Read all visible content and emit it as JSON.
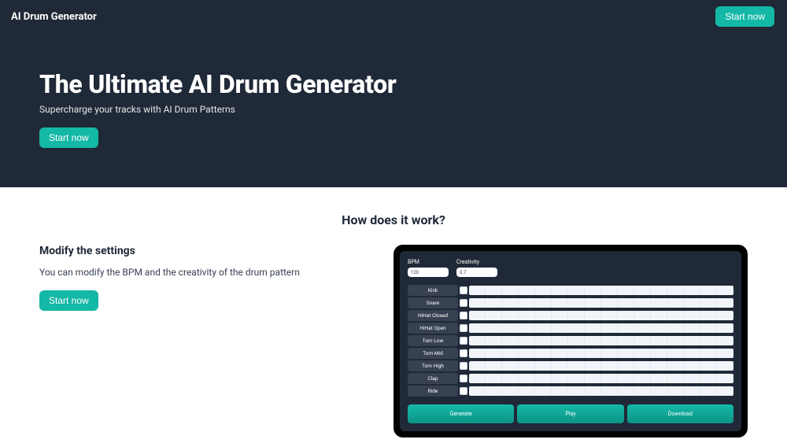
{
  "brand": "AI Drum Generator",
  "nav": {
    "cta": "Start now"
  },
  "hero": {
    "title": "The Ultimate AI Drum Generator",
    "subtitle": "Supercharge your tracks with AI Drum Patterns",
    "cta": "Start now"
  },
  "how": {
    "heading": "How does it work?",
    "step_title": "Modify the settings",
    "step_desc": "You can modify the BPM and the creativity of the drum pattern",
    "step_cta": "Start now"
  },
  "mock": {
    "controls": [
      {
        "label": "BPM",
        "value": "120"
      },
      {
        "label": "Creativity",
        "value": "0.7"
      }
    ],
    "tracks": [
      "Kick",
      "Snare",
      "HiHat Closed",
      "HiHat Open",
      "Tom Low",
      "Tom Mid",
      "Tom High",
      "Clap",
      "Ride"
    ],
    "actions": [
      "Generate",
      "Play",
      "Download"
    ]
  }
}
